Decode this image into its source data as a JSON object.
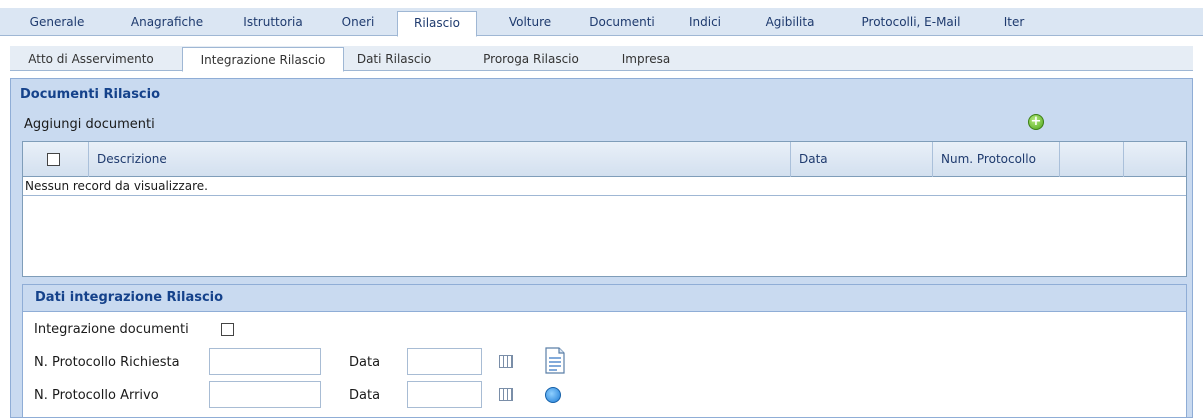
{
  "main_tabs": [
    {
      "label": "Generale"
    },
    {
      "label": "Anagrafiche"
    },
    {
      "label": "Istruttoria"
    },
    {
      "label": "Oneri"
    },
    {
      "label": "Rilascio"
    },
    {
      "label": "Volture"
    },
    {
      "label": "Documenti"
    },
    {
      "label": "Indici"
    },
    {
      "label": "Agibilita"
    },
    {
      "label": "Protocolli, E-Mail"
    },
    {
      "label": "Iter"
    }
  ],
  "sub_tabs": [
    {
      "label": "Atto di Asservimento"
    },
    {
      "label": "Integrazione Rilascio"
    },
    {
      "label": "Dati Rilascio"
    },
    {
      "label": "Proroga Rilascio"
    },
    {
      "label": "Impresa"
    }
  ],
  "documents": {
    "title": "Documenti Rilascio",
    "add_label": "Aggiungi documenti",
    "columns": [
      "Descrizione",
      "Data",
      "Num. Protocollo"
    ],
    "empty_message": "Nessun record da visualizzare."
  },
  "integration": {
    "title": "Dati integrazione Rilascio",
    "documents_label": "Integrazione documenti",
    "request_protocol_label": "N. Protocollo Richiesta",
    "arrival_protocol_label": "N. Protocollo Arrivo",
    "date_label": "Data",
    "request_protocol_value": "",
    "request_date_value": "",
    "arrival_protocol_value": "",
    "arrival_date_value": ""
  }
}
